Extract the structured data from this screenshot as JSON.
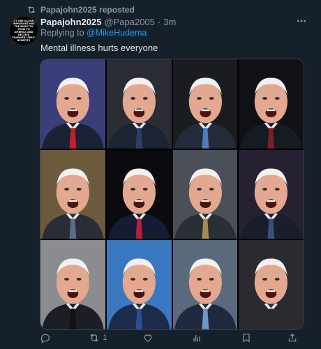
{
  "repost": {
    "text": "Papajohn2025 reposted"
  },
  "avatar": {
    "text": "LET ONE ILLEGAL IMMIGRANT HAS THE RIGHT TO COME TO AMERICA AND RECEIVE TAXPAYER \"FREE\" BENEFITS"
  },
  "post": {
    "author": "Papajohn2025",
    "handle": "@Papa2005",
    "separator": "·",
    "time": "3m",
    "reply_prefix": "Replying to ",
    "reply_mention": "@MikeHudema",
    "text": "Mental illness hurts everyone"
  },
  "media": {
    "tiles": [
      {
        "bg": "#3a3f7a",
        "suit": "#1b2233",
        "tie": "#c0202a",
        "expression": "shouting"
      },
      {
        "bg": "#2a2d33",
        "suit": "#1c2433",
        "tie": "#2d3e64",
        "expression": "shouting"
      },
      {
        "bg": "#1a1d20",
        "suit": "#232a3a",
        "tie": "#4f7cc1",
        "expression": "shouting"
      },
      {
        "bg": "#0f1114",
        "suit": "#161a22",
        "tie": "#7a1f22",
        "expression": "shouting"
      },
      {
        "bg": "#6c5a3c",
        "suit": "#2a2d36",
        "tie": "#5d6d88",
        "expression": "shouting"
      },
      {
        "bg": "#0a0a0f",
        "suit": "#141b33",
        "tie": "#b2203a",
        "expression": "shouting"
      },
      {
        "bg": "#4a4f58",
        "suit": "#2a2e36",
        "tie": "#a58a52",
        "expression": "shouting"
      },
      {
        "bg": "#262033",
        "suit": "#1a1d2b",
        "tie": "#3a4f7a",
        "expression": "shouting"
      },
      {
        "bg": "#8a8c90",
        "suit": "#1b1e24",
        "tie": "#121212",
        "expression": "shouting"
      },
      {
        "bg": "#3a78c0",
        "suit": "#1d2b4a",
        "tie": "#2d4f8f",
        "expression": "shouting"
      },
      {
        "bg": "#5a6a7c",
        "suit": "#1f2a40",
        "tie": "#6b96c8",
        "expression": "shouting"
      },
      {
        "bg": "#2a2a30",
        "suit": "#2a2a2f",
        "tie": "#2a2a2f",
        "expression": "shouting"
      }
    ]
  },
  "actions": {
    "reply_count": "",
    "repost_count": "1",
    "like_count": "",
    "views_count": "",
    "accent_repost": "#8b98a5"
  }
}
